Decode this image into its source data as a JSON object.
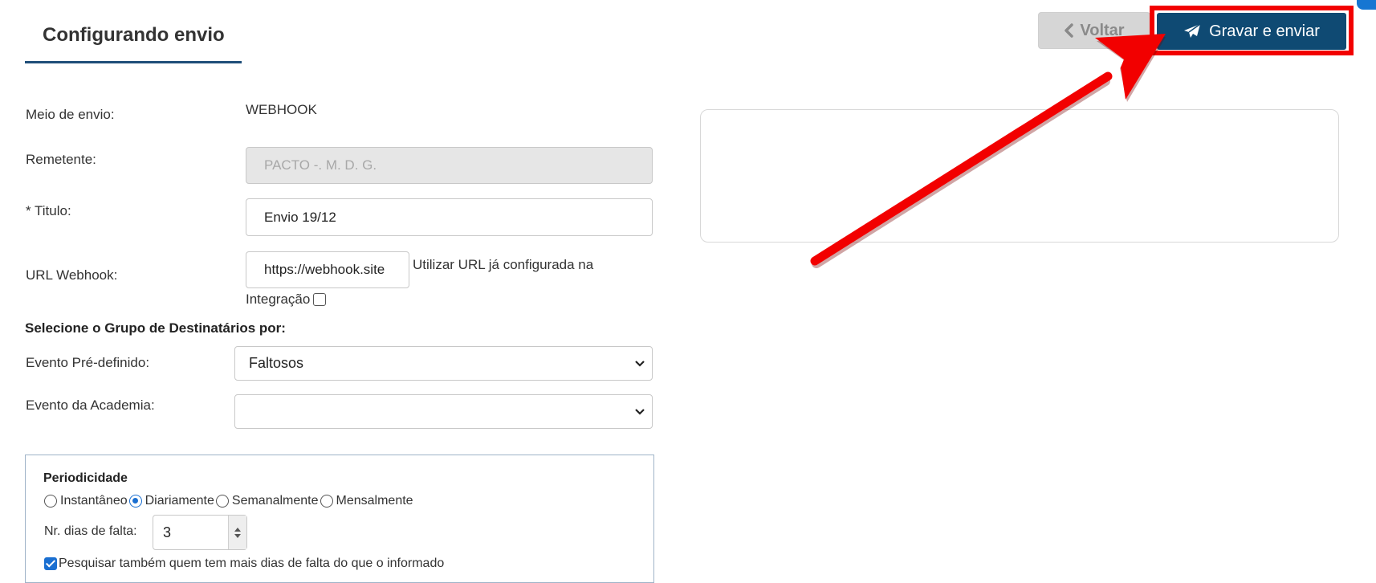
{
  "header": {
    "tab_title": "Configurando envio",
    "back_label": "Voltar",
    "save_send_label": "Gravar e enviar"
  },
  "form": {
    "meio_envio": {
      "label": "Meio de envio:",
      "value": "WEBHOOK"
    },
    "remetente": {
      "label": "Remetente:",
      "value": "PACTO -. M. D. G."
    },
    "titulo": {
      "label": "* Titulo:",
      "value": "Envio 19/12"
    },
    "url_webhook": {
      "label": "URL Webhook:",
      "value": "https://webhook.site",
      "use_configured_label_1": "Utilizar URL já configurada na",
      "use_configured_label_2": "Integração",
      "use_configured_checked": false
    }
  },
  "recipients": {
    "section_title": "Selecione o Grupo de Destinatários por:",
    "evento_predefinido": {
      "label": "Evento Pré-definido:",
      "value": "Faltosos"
    },
    "evento_academia": {
      "label": "Evento da Academia:",
      "value": ""
    }
  },
  "periodicidade": {
    "title": "Periodicidade",
    "options": [
      "Instantâneo",
      "Diariamente",
      "Semanalmente",
      "Mensalmente"
    ],
    "selected": "Diariamente",
    "dias_falta_label": "Nr. dias de falta:",
    "dias_falta_value": "3",
    "pesquisar_label": "Pesquisar também quem tem mais dias de falta do que o informado",
    "pesquisar_checked": true
  },
  "colors": {
    "primary": "#0f4a73",
    "highlight": "#f20000",
    "tab_underline": "#1f4e79",
    "radio_checked": "#1a6fd1"
  }
}
